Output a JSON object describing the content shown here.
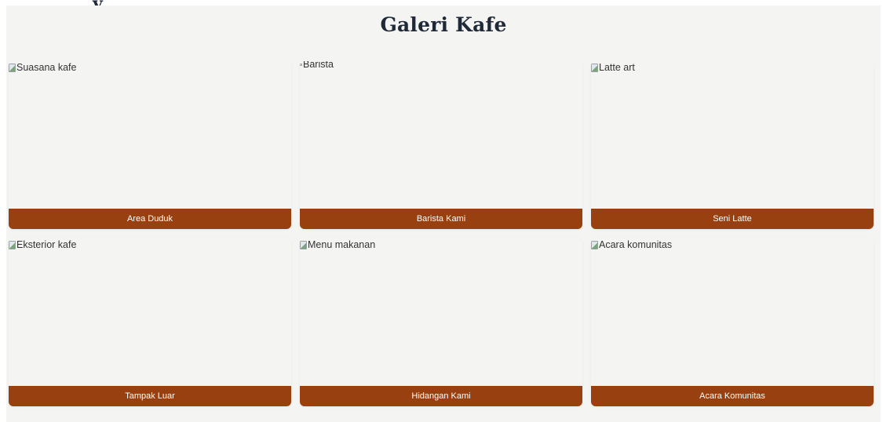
{
  "top_cut_text": "…y",
  "gallery": {
    "title": "Galeri Kafe",
    "colors": {
      "background": "#f4f4f3",
      "caption_bar": "#98400f",
      "caption_text": "#ffffff",
      "title": "#1f2937"
    },
    "items": [
      {
        "alt": "Suasana kafe",
        "caption": "Area Duduk",
        "icon": "broken-image-icon"
      },
      {
        "alt": "Barista",
        "caption": "Barista Kami",
        "icon": "broken-image-icon"
      },
      {
        "alt": "Latte art",
        "caption": "Seni Latte",
        "icon": "broken-image-icon"
      },
      {
        "alt": "Eksterior kafe",
        "caption": "Tampak Luar",
        "icon": "broken-image-icon"
      },
      {
        "alt": "Menu makanan",
        "caption": "Hidangan Kami",
        "icon": "broken-image-icon"
      },
      {
        "alt": "Acara komunitas",
        "caption": "Acara Komunitas",
        "icon": "broken-image-icon"
      }
    ]
  }
}
